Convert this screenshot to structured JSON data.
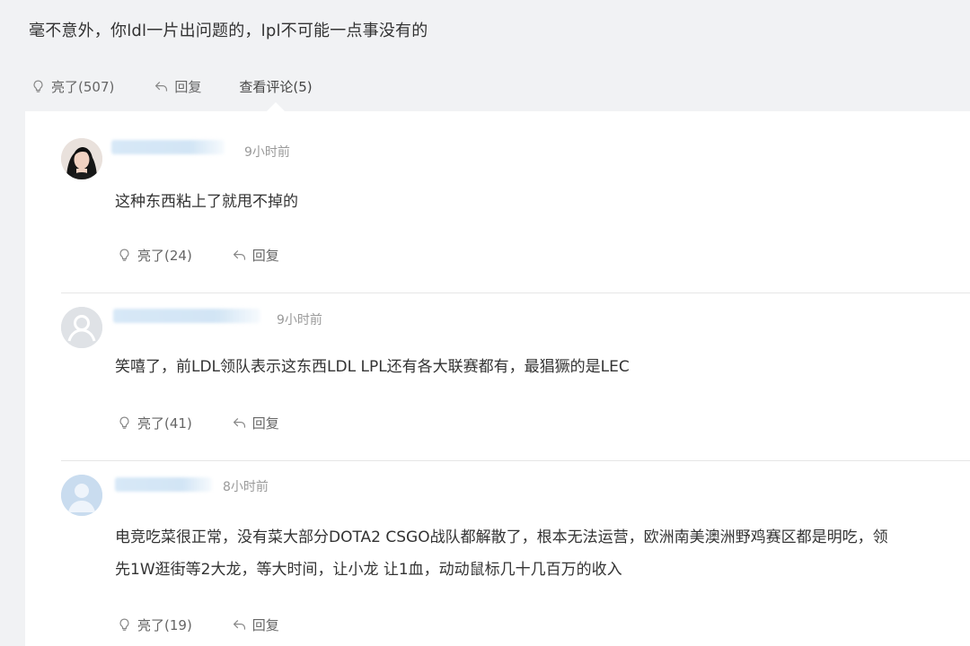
{
  "parent": {
    "text": "毫不意外，你ldl一片出问题的，lpl不可能一点事没有的",
    "like_label": "亮了(507)",
    "reply_label": "回复",
    "view_comments_label": "查看评论(5)"
  },
  "comments": [
    {
      "time": "9小时前",
      "text": "这种东西粘上了就甩不掉的",
      "like_label": "亮了(24)",
      "reply_label": "回复"
    },
    {
      "time": "9小时前",
      "text": "笑嘻了，前LDL领队表示这东西LDL LPL还有各大联赛都有，最猖獗的是LEC",
      "like_label": "亮了(41)",
      "reply_label": "回复"
    },
    {
      "time": "8小时前",
      "text_line1": "电竞吃菜很正常，没有菜大部分DOTA2 CSGO战队都解散了，根本无法运营，欧洲南美澳洲野鸡赛区都是明吃，领",
      "text_line2": "先1W逛街等2大龙，等大时间，让小龙 让1血，动动鼠标几十几百万的收入",
      "like_label": "亮了(19)",
      "reply_label": "回复"
    }
  ],
  "icons": {
    "like": "lightbulb-icon",
    "reply": "reply-arrow-icon"
  }
}
